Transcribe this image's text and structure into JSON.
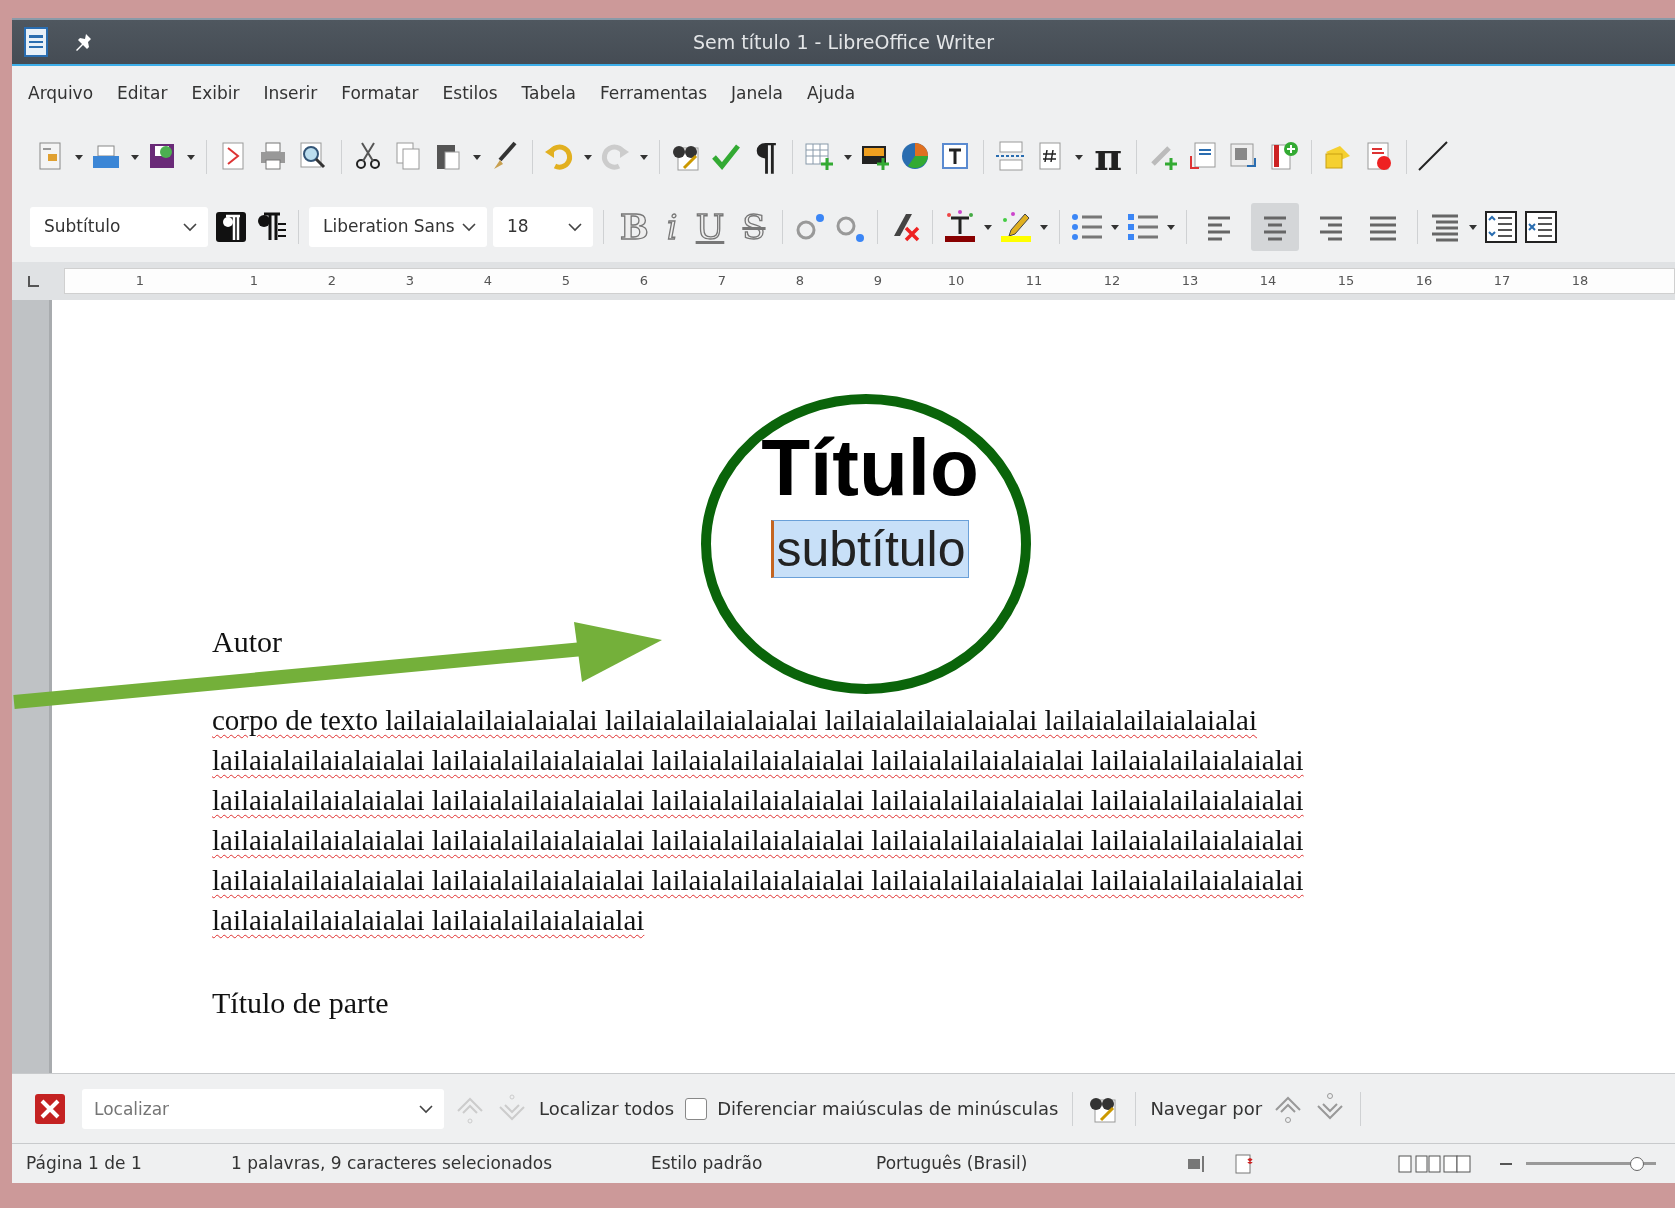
{
  "window": {
    "title": "Sem título 1 - LibreOffice Writer"
  },
  "menu": [
    {
      "label": "Arquivo"
    },
    {
      "label": "Editar"
    },
    {
      "label": "Exibir"
    },
    {
      "label": "Inserir"
    },
    {
      "label": "Formatar"
    },
    {
      "label": "Estilos"
    },
    {
      "label": "Tabela"
    },
    {
      "label": "Ferramentas"
    },
    {
      "label": "Janela"
    },
    {
      "label": "Ajuda"
    }
  ],
  "standard_toolbar": {
    "glyphs": {
      "pilcrow": "¶",
      "pi": "π"
    }
  },
  "formatting_toolbar": {
    "paragraph_style": "Subtítulo",
    "font_name": "Liberation Sans",
    "font_size": "18",
    "bold": "B",
    "italic": "i",
    "underline": "U",
    "strikethrough": "S",
    "alignment": [
      {
        "selected": false
      },
      {
        "selected": true
      },
      {
        "selected": false
      },
      {
        "selected": false
      }
    ]
  },
  "ruler": {
    "labels": [
      "1",
      "1",
      "2",
      "3",
      "4",
      "5",
      "6",
      "7",
      "8",
      "9",
      "10",
      "11",
      "12",
      "13",
      "14",
      "15",
      "16",
      "17",
      "18"
    ]
  },
  "document": {
    "title": "Título",
    "subtitle": "subtítulo",
    "author": "Autor",
    "body": "corpo de texto lailaialailaialaialai lailaialailaialaialai lailaialailaialaialai lailaialailaialaialai lailaialailaialaialai lailaialailaialaialai lailaialailaialaialai lailaialailaialaialai lailaialailaialaialai lailaialailaialaialai lailaialailaialaialai lailaialailaialaialai lailaialailaialaialai lailaialailaialaialai lailaialailaialaialai lailaialailaialaialai lailaialailaialaialai lailaialailaialaialai lailaialailaialaialai lailaialailaialaialai lailaialailaialaialai lailaialailaialaialai lailaialailaialaialai lailaialailaialaialai lailaialailaialaialai lailaialailaialaialai",
    "heading": "Título de parte"
  },
  "find_bar": {
    "placeholder": "Localizar",
    "find_all": "Localizar todos",
    "match_case": {
      "label": "Diferenciar maiúsculas de minúsculas",
      "checked": false
    },
    "navigate": "Navegar por"
  },
  "status_bar": {
    "page": "Página 1 de 1",
    "selection": "1 palavras, 9 caracteres selecionados",
    "page_style": "Estilo padrão",
    "language": "Português (Brasil)",
    "zoom": {
      "level": 0.85
    }
  }
}
